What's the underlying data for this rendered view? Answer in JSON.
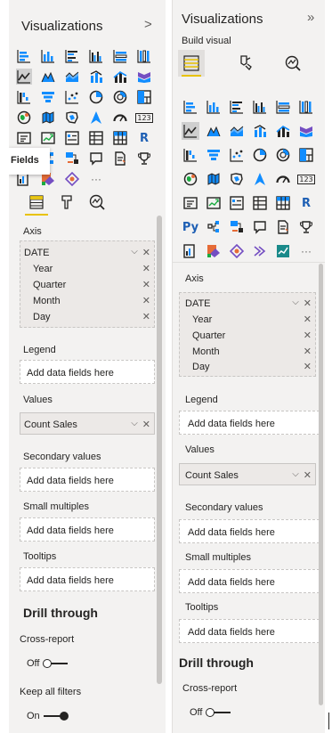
{
  "left": {
    "title": "Visualizations",
    "chevron": ">",
    "tooltip": "Fields",
    "sections": {
      "axis": "Axis",
      "legend": "Legend",
      "values": "Values",
      "secondary": "Secondary values",
      "small_multiples": "Small multiples",
      "tooltips": "Tooltips"
    },
    "axis_field": "DATE",
    "axis_items": [
      "Year",
      "Quarter",
      "Month",
      "Day"
    ],
    "values_field": "Count Sales",
    "placeholder": "Add data fields here",
    "drill_title": "Drill through",
    "cross_report": "Cross-report",
    "cross_report_state": "Off",
    "keep_filters": "Keep all filters",
    "keep_filters_state": "On"
  },
  "right": {
    "title": "Visualizations",
    "chevron": "»",
    "build_visual": "Build visual",
    "sections": {
      "axis": "Axis",
      "legend": "Legend",
      "values": "Values",
      "secondary": "Secondary values",
      "small_multiples": "Small multiples",
      "tooltips": "Tooltips"
    },
    "axis_field": "DATE",
    "axis_items": [
      "Year",
      "Quarter",
      "Month",
      "Day"
    ],
    "values_field": "Count Sales",
    "placeholder": "Add data fields here",
    "drill_title": "Drill through",
    "cross_report": "Cross-report",
    "cross_report_state": "Off"
  },
  "icon_text": {
    "r": "R",
    "py": "Py",
    "kpi": "123",
    "more": "···"
  },
  "colors": {
    "accent": "#e8c200",
    "blue": "#118dff",
    "dark": "#252423",
    "purple": "#744ec2",
    "orange": "#e66c37",
    "teal": "#1aab40"
  }
}
